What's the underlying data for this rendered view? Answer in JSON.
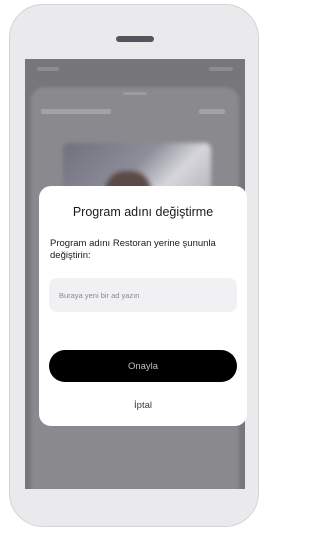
{
  "dialog": {
    "title": "Program adını değiştirme",
    "message": "Program adını Restoran yerine şununla değiştirin:",
    "input_value": "",
    "input_placeholder": "Buraya yeni bir ad yazın",
    "confirm_label": "Onayla",
    "cancel_label": "İptal"
  },
  "colors": {
    "confirm_button_bg": "#000000",
    "backdrop": "#77777b",
    "dialog_bg": "#ffffff"
  }
}
